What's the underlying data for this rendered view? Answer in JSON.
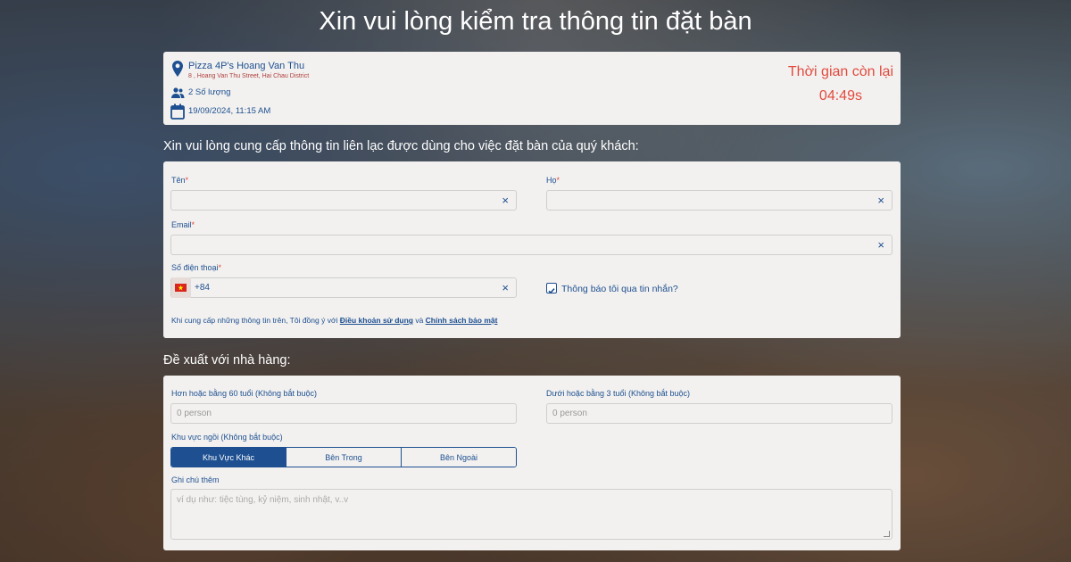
{
  "page": {
    "title": "Xin vui lòng kiểm tra thông tin đặt bàn"
  },
  "booking": {
    "restaurant_name": "Pizza 4P's Hoang Van Thu",
    "restaurant_address": "8 , Hoang Van Thu Street, Hai Chau District",
    "party_size": "2 Số lượng",
    "datetime": "19/09/2024, 11:15 AM"
  },
  "timer": {
    "label": "Thời gian còn lại",
    "value": "04:49s"
  },
  "contact": {
    "section_title": "Xin vui lòng cung cấp thông tin liên lạc được dùng cho việc đặt bàn của quý khách:",
    "first_name_label": "Tên",
    "last_name_label": "Họ",
    "email_label": "Email",
    "phone_label": "Số điện thoại",
    "required_mark": "*",
    "clear_glyph": "×",
    "phone_code": "+84",
    "sms_label": "Thông báo tôi qua tin nhắn?",
    "sms_checked": true,
    "terms_prefix": "Khi cung cấp những thông tin trên, Tôi đồng ý với ",
    "terms_link": "Điều khoản sử dụng",
    "terms_and": " và ",
    "privacy_link": "Chính sách bảo mật"
  },
  "extra": {
    "section_title": "Đề xuất với nhà hàng:",
    "senior_label": "Hơn hoặc bằng 60 tuổi (Không bắt buộc)",
    "senior_placeholder": "0 person",
    "child_label": "Dưới hoặc bằng 3 tuổi (Không bắt buộc)",
    "child_placeholder": "0 person",
    "seating_label": "Khu vực ngồi (Không bắt buộc)",
    "seating_options": [
      "Khu Vực Khác",
      "Bên Trong",
      "Bên Ngoài"
    ],
    "seating_selected": "Khu Vực Khác",
    "note_label": "Ghi chú thêm",
    "note_placeholder": "ví dụ như: tiệc tùng, kỷ niệm, sinh nhật, v..v"
  },
  "colors": {
    "accent": "#1d4f91",
    "timer": "#e24a3f",
    "card": "#f2f1ef"
  }
}
